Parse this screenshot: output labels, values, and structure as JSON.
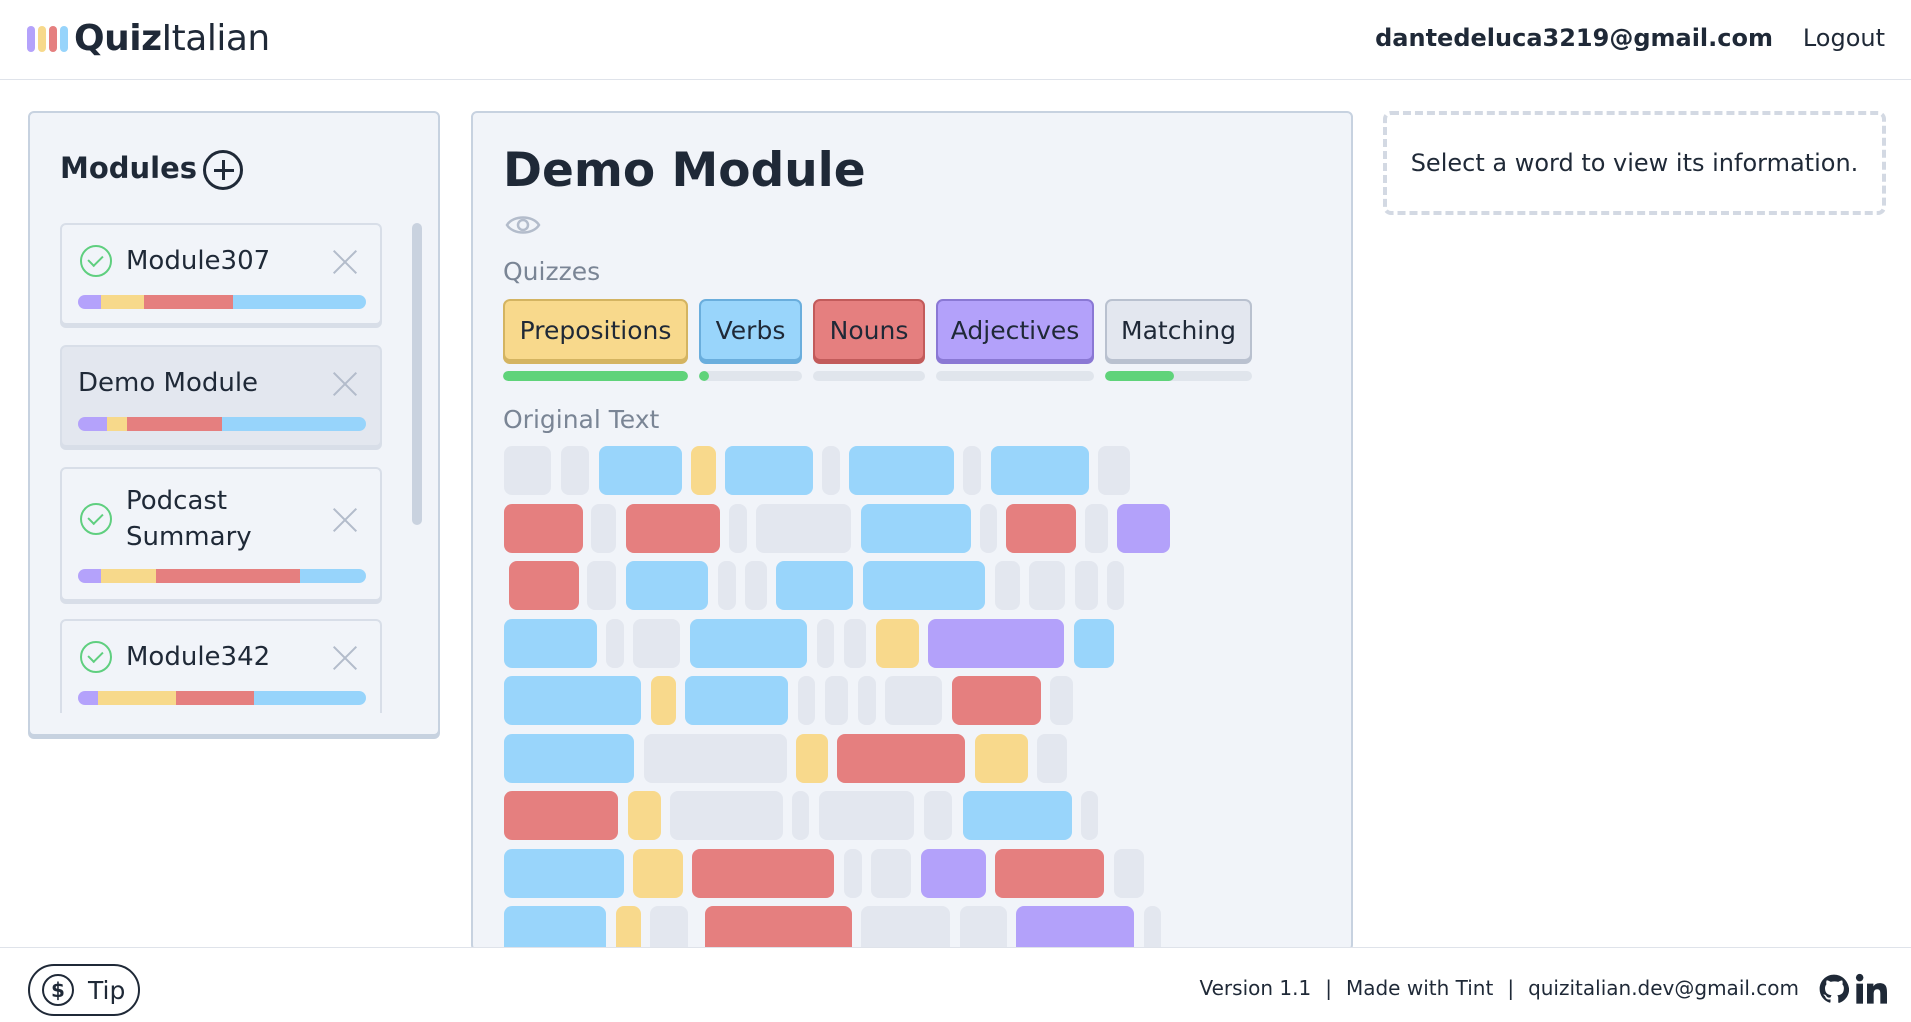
{
  "app": {
    "logo_quiz": "Quiz",
    "logo_italian": "Italian",
    "logo_colors": [
      "#b4a2fb",
      "#f7d98b",
      "#e57f7f",
      "#97d4fb"
    ]
  },
  "header": {
    "email": "dantedeluca3219@gmail.com",
    "logout": "Logout"
  },
  "sidebar": {
    "title": "Modules",
    "modules": [
      {
        "name": "Module307",
        "completed": true,
        "progress": [
          0.08,
          0.15,
          0.31,
          0.46
        ]
      },
      {
        "name": "Demo Module",
        "completed": false,
        "active": true,
        "progress": [
          0.1,
          0.07,
          0.33,
          0.5
        ]
      },
      {
        "name_line1": "Podcast",
        "name_line2": "Summary",
        "completed": true,
        "progress": [
          0.08,
          0.19,
          0.5,
          0.23
        ]
      },
      {
        "name": "Module342",
        "completed": true,
        "progress": [
          0.07,
          0.27,
          0.27,
          0.39
        ]
      }
    ]
  },
  "main": {
    "title": "Demo Module",
    "quizzes_label": "Quizzes",
    "quizzes": [
      {
        "label": "Prepositions",
        "color": "#f8d98c",
        "border": "#d4b461",
        "progress": 1.0
      },
      {
        "label": "Verbs",
        "color": "#99d5fb",
        "border": "#6aaedd",
        "progress": 0.1
      },
      {
        "label": "Nouns",
        "color": "#e57f7f",
        "border": "#c25b5b",
        "progress": 0.0
      },
      {
        "label": "Adjectives",
        "color": "#b3a1fa",
        "border": "#8a78d4",
        "progress": 0.0
      },
      {
        "label": "Matching",
        "color": "#e3e7ef",
        "border": "#b9c1cf",
        "progress": 0.47
      }
    ],
    "original_text_label": "Original Text",
    "word_colors": {
      "g": "#e3e7ef",
      "b": "#99d5fb",
      "y": "#f8d98c",
      "r": "#e57f7f",
      "p": "#b3a1fa"
    }
  },
  "info": {
    "text": "Select a word to view its information."
  },
  "footer": {
    "tip": "Tip",
    "version": "Version 1.1",
    "made_with": "Made with Tint",
    "contact": "quizitalian.dev@gmail.com",
    "separator": "|"
  }
}
